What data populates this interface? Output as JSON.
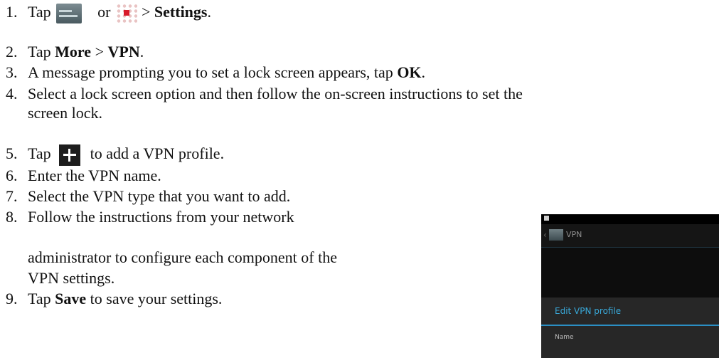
{
  "steps": [
    {
      "num": "1.",
      "tap": "Tap",
      "or": "or",
      "sep": ">",
      "settings": "Settings",
      "end": "."
    },
    {
      "num": "2.",
      "tap": "Tap",
      "more": "More",
      "sep": ">",
      "vpn": "VPN",
      "end": "."
    },
    {
      "num": "3.",
      "text": "A message prompting you to set a lock screen appears, tap",
      "ok": "OK",
      "end": "."
    },
    {
      "num": "4.",
      "line1": "Select a lock screen option and then follow the on-screen instructions to set the",
      "line2": "screen lock."
    },
    {
      "num": "5.",
      "tap": "Tap",
      "text": "to add a VPN profile."
    },
    {
      "num": "6.",
      "text": "Enter the VPN name."
    },
    {
      "num": "7.",
      "text": "Select the VPN type that you want to add."
    },
    {
      "num": "8.",
      "line1": "Follow the instructions from your network",
      "line2": "administrator to configure each component of the",
      "line3": "VPN settings."
    },
    {
      "num": "9.",
      "tap": "Tap",
      "save": "Save",
      "text": "to save your settings."
    }
  ],
  "icons": {
    "settings_app": "settings-app-icon",
    "app_grid": "app-grid-icon",
    "add": "plus-icon"
  },
  "phone_screenshot": {
    "title": "VPN",
    "dialog_title": "Edit VPN profile",
    "field_label": "Name",
    "accent_color": "#2b8fc4"
  }
}
